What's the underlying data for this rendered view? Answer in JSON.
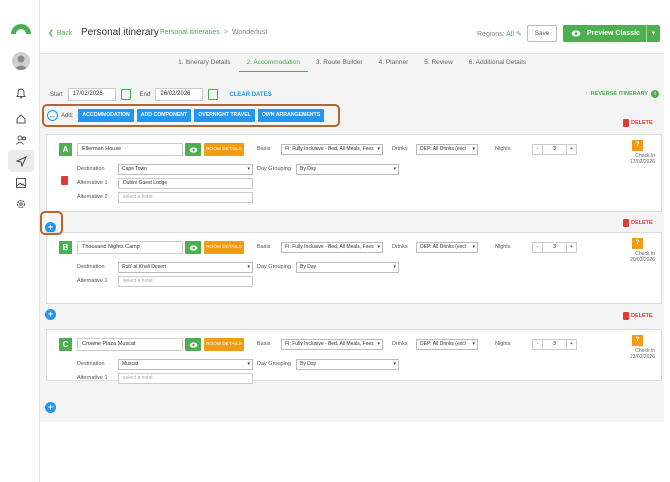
{
  "header": {
    "back_label": "Back",
    "title": "Personal itinerary",
    "breadcrumb_link": "Personal itineraries",
    "breadcrumb_sep": ">",
    "breadcrumb_current": "Wonderlust",
    "regions_label": "Regions:",
    "regions_value": "All",
    "save_label": "Save",
    "preview_label": "Preview Classic"
  },
  "steps": [
    {
      "label": "1. Itinerary Details"
    },
    {
      "label": "2. Accommodation",
      "active": true
    },
    {
      "label": "3. Route Builder"
    },
    {
      "label": "4. Planner"
    },
    {
      "label": "5. Review"
    },
    {
      "label": "6. Additional Details"
    }
  ],
  "dates": {
    "start_label": "Start",
    "start_value": "17/02/2026",
    "end_label": "End",
    "end_value": "26/02/2026",
    "clear_label": "CLEAR DATES"
  },
  "reverse_label": "REVERSE ITINERARY",
  "add_bar": {
    "add_label": "Add:",
    "buttons": [
      "ACCOMMODATION",
      "ADD COMPONENT",
      "OVERNIGHT TRAVEL",
      "OWN ARRANGEMENTS"
    ]
  },
  "delete_label": "DELETE",
  "labels": {
    "basis": "Basis",
    "drinks": "Drinks",
    "nights": "Nights",
    "destination": "Destination",
    "day_grouping": "Day Grouping",
    "alternative_1": "Alternative 1",
    "alternative_2": "Alternative 2",
    "room_details": "ROOM DETAILS",
    "check_in": "Check In",
    "select_hotel": "select a hotel"
  },
  "cards": [
    {
      "letter": "A",
      "hotel": "Ellerman House",
      "basis": "FI: Fully Inclusive - Bed, All Meals, Fees",
      "drinks": "DEP: All Drinks (excl",
      "nights": "3",
      "destination": "Cape Town",
      "day_grouping": "By Day",
      "alternative_1": "Dubini Guest Lodge",
      "alternative_2": "",
      "check_in_date": "17/02/2026"
    },
    {
      "letter": "B",
      "hotel": "Thousand Nights Camp",
      "basis": "FI: Fully Inclusive - Bed, All Meals, Fees",
      "drinks": "DEP: All Drinks (excl",
      "nights": "3",
      "destination": "Rub' al Khali Desert",
      "day_grouping": "By Day",
      "alternative_1": "",
      "check_in_date": "20/02/2026"
    },
    {
      "letter": "C",
      "hotel": "Crowne Plaza Muscat",
      "basis": "FI: Fully Inclusive - Bed, All Meals, Fees",
      "drinks": "DEP: All Drinks (excl",
      "nights": "3",
      "destination": "Muscat",
      "day_grouping": "By Day",
      "alternative_1": "",
      "check_in_date": "23/02/2026"
    }
  ],
  "stepper": {
    "minus": "-",
    "plus": "+"
  },
  "colors": {
    "green": "#4caf50",
    "blue": "#2196f3",
    "orange": "#f39c12",
    "red": "#e53935",
    "highlight": "#b5652e"
  }
}
